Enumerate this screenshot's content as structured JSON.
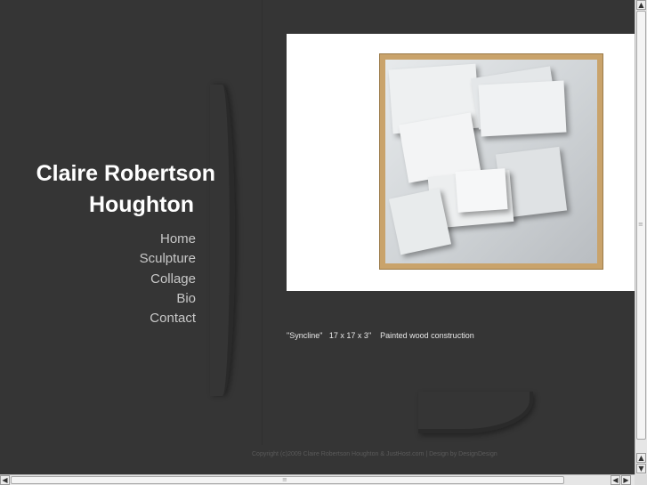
{
  "site": {
    "title_line1": "Claire Robertson",
    "title_line2": "Houghton"
  },
  "nav": {
    "items": [
      {
        "label": "Home"
      },
      {
        "label": "Sculpture"
      },
      {
        "label": "Collage"
      },
      {
        "label": "Bio"
      },
      {
        "label": "Contact"
      }
    ]
  },
  "artwork": {
    "caption": "\"Syncline\"   17 x 17 x 3\"    Painted wood construction"
  },
  "footer": {
    "text": "Copyright (c)2009 Claire Robertson Houghton & JustHost.com | Design by DesignDesign"
  },
  "scrollbars": {
    "up_arrow": "▲",
    "down_arrow": "▼",
    "left_arrow": "◀",
    "right_arrow": "▶",
    "grip": "≡"
  },
  "colors": {
    "background": "#353535",
    "title": "#ffffff",
    "nav": "#c8c8c8",
    "frame": "#c9a36b"
  }
}
